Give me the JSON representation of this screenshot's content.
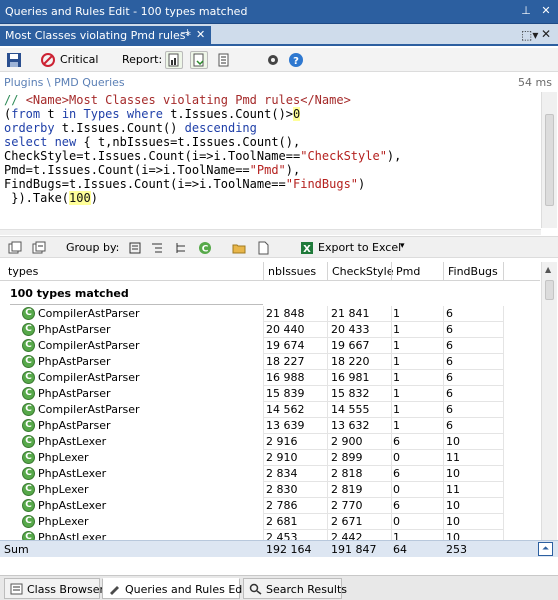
{
  "window": {
    "title": "Queries and Rules Edit  - 100 types matched"
  },
  "tab": {
    "label": "Most Classes violating Pmd rules*"
  },
  "toolbar": {
    "critical_label": "Critical",
    "report_label": "Report:"
  },
  "breadcrumb": "Plugins \\ PMD Queries",
  "elapsed": "54 ms",
  "code": {
    "line1_comment": "// ",
    "line1_tag_open": "<Name>",
    "line1_name": "Most Classes violating Pmd rules",
    "line1_tag_close": "</Name>",
    "line2_a": "(",
    "line2_from": "from",
    "line2_b": " t ",
    "line2_in": "in",
    "line2_types": " Types ",
    "line2_where": "where",
    "line2_c": " t.Issues.Count()>",
    "line2_zero": "0",
    "line3_orderby": "orderby",
    "line3_rest": " t.Issues.Count() ",
    "line3_desc": "descending",
    "line4_select": "select",
    "line4_new": " new",
    "line4_rest": " { t,nbIssues=t.Issues.Count(),",
    "line5_a": "CheckStyle=t.Issues.Count(i=>i.ToolName==",
    "line5_str": "\"CheckStyle\"",
    "line5_b": "),",
    "line6_a": "Pmd=t.Issues.Count(i=>i.ToolName==",
    "line6_str": "\"Pmd\"",
    "line6_b": "),",
    "line7_a": "FindBugs=t.Issues.Count(i=>i.ToolName==",
    "line7_str": "\"FindBugs\"",
    "line7_b": ")",
    "line8_a": " }).Take(",
    "line8_num": "100",
    "line8_b": ")"
  },
  "results_toolbar": {
    "group_by_label": "Group by:",
    "export_label": "Export to Excel"
  },
  "table": {
    "columns": [
      "types",
      "nbIssues",
      "CheckStyle",
      "Pmd",
      "FindBugs"
    ],
    "group_label": "100 types matched",
    "rows": [
      {
        "name": "CompilerAstParser",
        "nbIssues": "21 848",
        "checkstyle": "21 841",
        "pmd": "1",
        "findbugs": "6"
      },
      {
        "name": "PhpAstParser",
        "nbIssues": "20 440",
        "checkstyle": "20 433",
        "pmd": "1",
        "findbugs": "6"
      },
      {
        "name": "CompilerAstParser",
        "nbIssues": "19 674",
        "checkstyle": "19 667",
        "pmd": "1",
        "findbugs": "6"
      },
      {
        "name": "PhpAstParser",
        "nbIssues": "18 227",
        "checkstyle": "18 220",
        "pmd": "1",
        "findbugs": "6"
      },
      {
        "name": "CompilerAstParser",
        "nbIssues": "16 988",
        "checkstyle": "16 981",
        "pmd": "1",
        "findbugs": "6"
      },
      {
        "name": "PhpAstParser",
        "nbIssues": "15 839",
        "checkstyle": "15 832",
        "pmd": "1",
        "findbugs": "6"
      },
      {
        "name": "CompilerAstParser",
        "nbIssues": "14 562",
        "checkstyle": "14 555",
        "pmd": "1",
        "findbugs": "6"
      },
      {
        "name": "PhpAstParser",
        "nbIssues": "13 639",
        "checkstyle": "13 632",
        "pmd": "1",
        "findbugs": "6"
      },
      {
        "name": "PhpAstLexer",
        "nbIssues": "2 916",
        "checkstyle": "2 900",
        "pmd": "6",
        "findbugs": "10"
      },
      {
        "name": "PhpLexer",
        "nbIssues": "2 910",
        "checkstyle": "2 899",
        "pmd": "0",
        "findbugs": "11"
      },
      {
        "name": "PhpAstLexer",
        "nbIssues": "2 834",
        "checkstyle": "2 818",
        "pmd": "6",
        "findbugs": "10"
      },
      {
        "name": "PhpLexer",
        "nbIssues": "2 830",
        "checkstyle": "2 819",
        "pmd": "0",
        "findbugs": "11"
      },
      {
        "name": "PhpAstLexer",
        "nbIssues": "2 786",
        "checkstyle": "2 770",
        "pmd": "6",
        "findbugs": "10"
      },
      {
        "name": "PhpLexer",
        "nbIssues": "2 681",
        "checkstyle": "2 671",
        "pmd": "0",
        "findbugs": "10"
      },
      {
        "name": "PhpAstLexer",
        "nbIssues": "2 453",
        "checkstyle": "2 442",
        "pmd": "1",
        "findbugs": "10"
      }
    ]
  },
  "sum": {
    "label": "Sum",
    "nbIssues": "192 164",
    "checkstyle": "191 847",
    "pmd": "64",
    "findbugs": "253"
  },
  "bottom_tabs": [
    {
      "label": "Class Browser"
    },
    {
      "label": "Queries and Rules Edit"
    },
    {
      "label": "Search Results"
    }
  ],
  "colors": {
    "accent": "#2c5fa0",
    "type_icon": "#57a94a"
  }
}
